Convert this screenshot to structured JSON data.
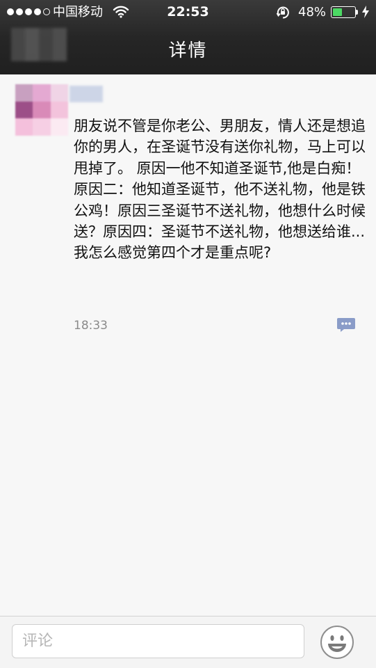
{
  "status_bar": {
    "carrier": "中国移动",
    "time": "22:53",
    "battery_percent": "48%",
    "battery_level": 0.48,
    "signal_icon": "signal-dots-icon",
    "wifi_icon": "wifi-icon",
    "rotation_lock_icon": "rotation-lock-icon",
    "charging_icon": "bolt-icon",
    "battery_color": "#4cd964"
  },
  "nav": {
    "title": "详情"
  },
  "post": {
    "body": "朋友说不管是你老公、男朋友，情人还是想追你的男人，在圣诞节没有送你礼物，马上可以甩掉了。 原因一他不知道圣诞节,他是白痴！原因二：他知道圣诞节，他不送礼物，他是铁公鸡！原因三圣诞节不送礼物，他想什么时候送？原因四：圣诞节不送礼物，他想送给谁...\n我怎么感觉第四个才是重点呢?",
    "time": "18:33",
    "comment_icon": "comment-bubble-icon"
  },
  "comment_bar": {
    "placeholder": "评论",
    "emoji_icon": "emoji-smiley-icon"
  },
  "colors": {
    "nav_bg": "#262626",
    "page_bg": "#f7f7f7",
    "comment_icon": "#8a9cc8"
  }
}
